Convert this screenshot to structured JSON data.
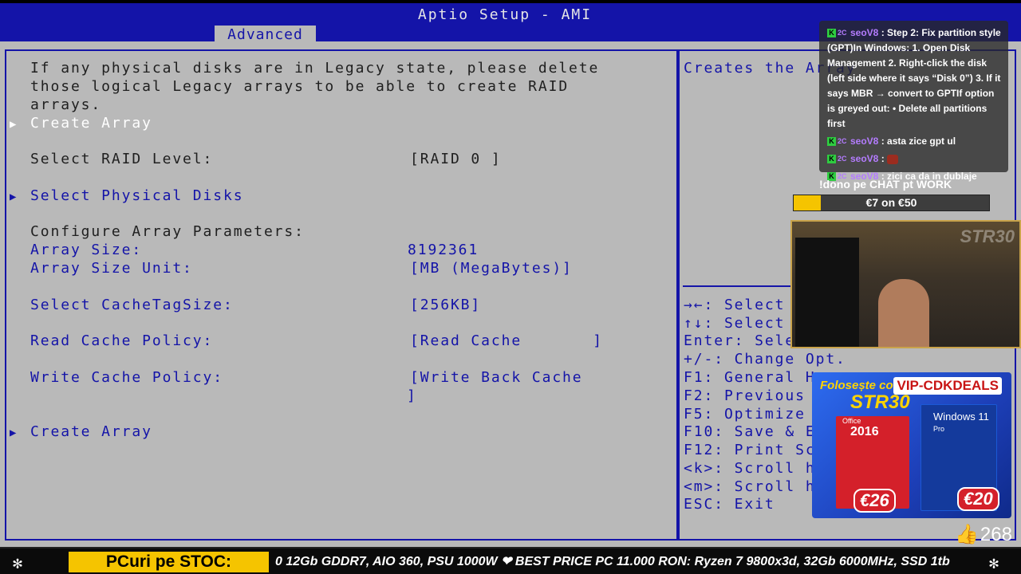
{
  "bios": {
    "window_title": "Aptio Setup - AMI",
    "active_tab": "Advanced",
    "description": [
      "If any physical disks are in Legacy state, please delete",
      "those logical Legacy arrays to be able to create RAID",
      "arrays."
    ],
    "create_array_top": "Create Array",
    "raid_level": {
      "label": "Select RAID Level:",
      "value": "[RAID 0 ]"
    },
    "select_physical_disks": "Select Physical Disks",
    "configure_header": "Configure Array Parameters:",
    "array_size": {
      "label": "Array Size:",
      "value": "8192361"
    },
    "array_size_unit": {
      "label": "Array Size Unit:",
      "value": "[MB (MegaBytes)]"
    },
    "cache_tag_size": {
      "label": "Select CacheTagSize:",
      "value": "[256KB]"
    },
    "read_cache_policy": {
      "label": "Read Cache Policy:",
      "value": "[Read Cache       ]"
    },
    "write_cache_policy": {
      "label": "Write Cache Policy:",
      "value_line1": "[Write Back Cache",
      "value_line2": "]"
    },
    "create_array_bottom": "Create Array"
  },
  "help": {
    "description": "Creates the Array",
    "keys": [
      "→←: Select",
      "↑↓: Select",
      "Enter: Sele",
      "+/-: Change Opt.",
      "F1: General H",
      "F2: Previous",
      "F5: Optimize",
      "F10: Save & E",
      "F12: Print Sc",
      "<k>: Scroll h",
      "<m>: Scroll h",
      "ESC: Exit"
    ]
  },
  "chat": {
    "messages": [
      {
        "user": "seoV8",
        "text": "Step 2: Fix partition style (GPT)In Windows: 1. Open Disk Management 2. Right-click the disk (left side where it says “Disk 0”) 3. If it says MBR → convert to GPTIf option is greyed out: • Delete all partitions first"
      },
      {
        "user": "seoV8",
        "text": "asta zice gpt ul"
      },
      {
        "user": "seoV8",
        "text": ""
      },
      {
        "user": "seoV8",
        "text": "zici ca da in dublaje"
      }
    ],
    "badge_k": "K",
    "badge_2c": "2C"
  },
  "donation": {
    "label": "!dono pe CHAT pt WORK",
    "progress_text": "€7 on €50",
    "progress_fraction": 0.14
  },
  "webcam": {
    "overlay_text": "STR30"
  },
  "ad": {
    "headline": "Folosește codul",
    "code": "STR30",
    "brand": "VIP-CDKDEALS",
    "product1_name": "Office",
    "product1_year": "2016",
    "product2_name": "Windows 11",
    "product2_edition": "Pro",
    "price1": "€26",
    "price2": "€20"
  },
  "likes": {
    "count": "268"
  },
  "ticker": {
    "label": "PCuri pe STOC:",
    "text": "0 12Gb GDDR7, AIO 360, PSU 1000W ❤ BEST PRICE PC 11.000 RON: Ryzen 7 9800x3d, 32Gb 6000MHz, SSD 1tb"
  },
  "colors": {
    "bios_blue": "#1414a8",
    "bios_gray": "#b9b9b9",
    "accent_yellow": "#f5c400"
  }
}
